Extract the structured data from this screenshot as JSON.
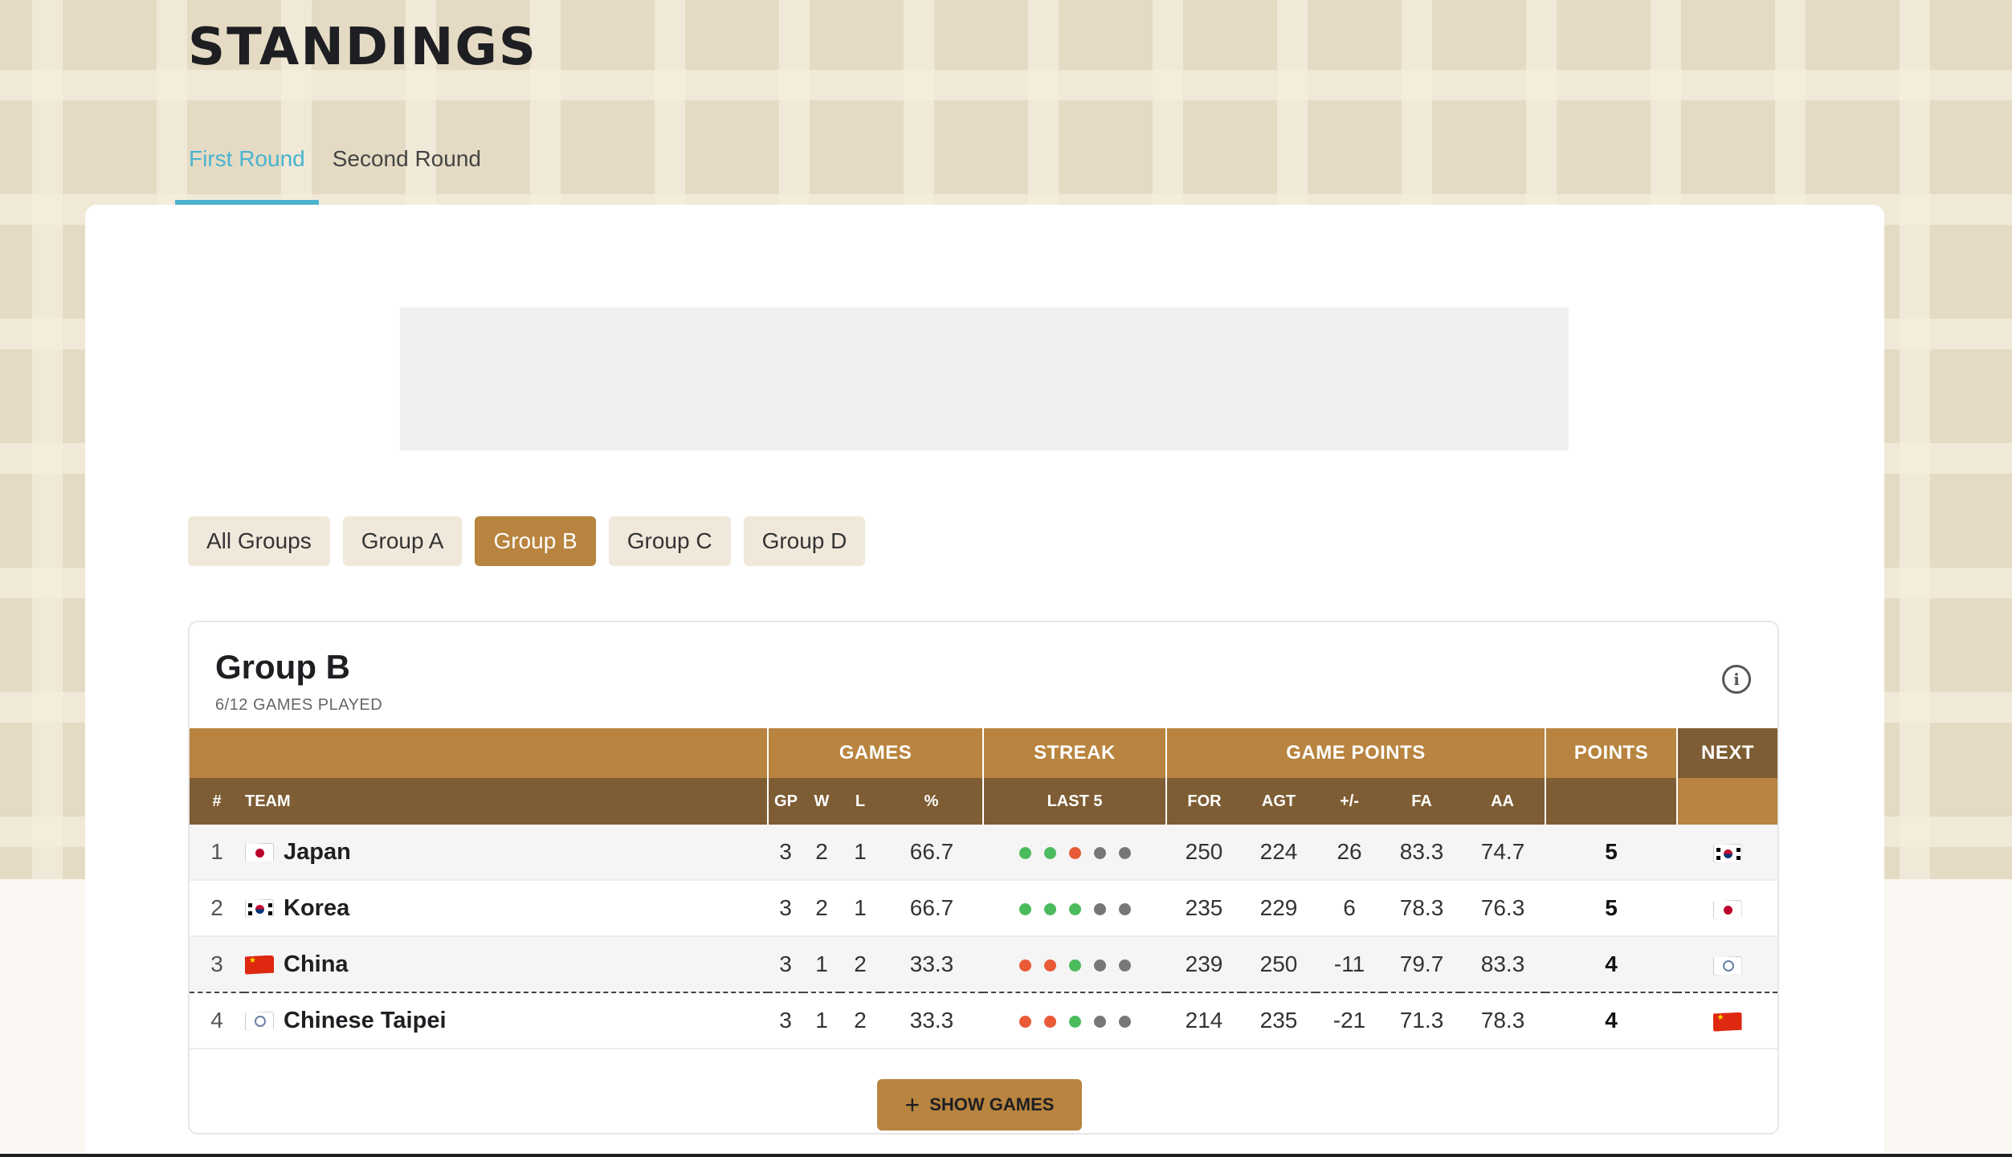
{
  "page": {
    "title": "STANDINGS"
  },
  "rounds": [
    {
      "label": "First Round",
      "active": true
    },
    {
      "label": "Second Round",
      "active": false
    }
  ],
  "group_filters": [
    {
      "label": "All Groups",
      "active": false
    },
    {
      "label": "Group A",
      "active": false
    },
    {
      "label": "Group B",
      "active": true
    },
    {
      "label": "Group C",
      "active": false
    },
    {
      "label": "Group D",
      "active": false
    }
  ],
  "panel": {
    "title": "Group B",
    "subtitle": "6/12 GAMES PLAYED",
    "info_icon": "i",
    "show_games_label": "SHOW GAMES",
    "show_games_icon": "+"
  },
  "table": {
    "group_headers": {
      "games": "GAMES",
      "streak": "STREAK",
      "game_points": "GAME POINTS",
      "points": "POINTS",
      "next": "NEXT"
    },
    "columns": {
      "rank": "#",
      "team": "TEAM",
      "gp": "GP",
      "w": "W",
      "l": "L",
      "pct": "%",
      "last5": "LAST 5",
      "for": "FOR",
      "agt": "AGT",
      "diff": "+/-",
      "fa": "FA",
      "aa": "AA"
    },
    "rows": [
      {
        "rank": "1",
        "flag": "jp-flag",
        "team": "Japan",
        "gp": "3",
        "w": "2",
        "l": "1",
        "pct": "66.7",
        "last5": [
          "W",
          "W",
          "L",
          "N",
          "N"
        ],
        "for": "250",
        "agt": "224",
        "diff": "26",
        "fa": "83.3",
        "aa": "74.7",
        "points": "5",
        "next_flag": "kr-flag"
      },
      {
        "rank": "2",
        "flag": "kr-flag",
        "team": "Korea",
        "gp": "3",
        "w": "2",
        "l": "1",
        "pct": "66.7",
        "last5": [
          "W",
          "W",
          "W",
          "N",
          "N"
        ],
        "for": "235",
        "agt": "229",
        "diff": "6",
        "fa": "78.3",
        "aa": "76.3",
        "points": "5",
        "next_flag": "jp-flag"
      },
      {
        "rank": "3",
        "flag": "cn-flag",
        "team": "China",
        "gp": "3",
        "w": "1",
        "l": "2",
        "pct": "33.3",
        "last5": [
          "L",
          "L",
          "W",
          "N",
          "N"
        ],
        "for": "239",
        "agt": "250",
        "diff": "-11",
        "fa": "79.7",
        "aa": "83.3",
        "points": "4",
        "next_flag": "tpe-flag"
      },
      {
        "rank": "4",
        "flag": "tpe-flag",
        "team": "Chinese Taipei",
        "gp": "3",
        "w": "1",
        "l": "2",
        "pct": "33.3",
        "last5": [
          "L",
          "L",
          "W",
          "N",
          "N"
        ],
        "for": "214",
        "agt": "235",
        "diff": "-21",
        "fa": "71.3",
        "aa": "78.3",
        "points": "4",
        "next_flag": "cn-flag"
      }
    ]
  },
  "colors": {
    "accent_blue": "#4ab3cf",
    "gold": "#b8843f",
    "brown": "#7e5d34",
    "win": "#4cbb5e",
    "loss": "#e95a36",
    "not_played": "#777777"
  }
}
